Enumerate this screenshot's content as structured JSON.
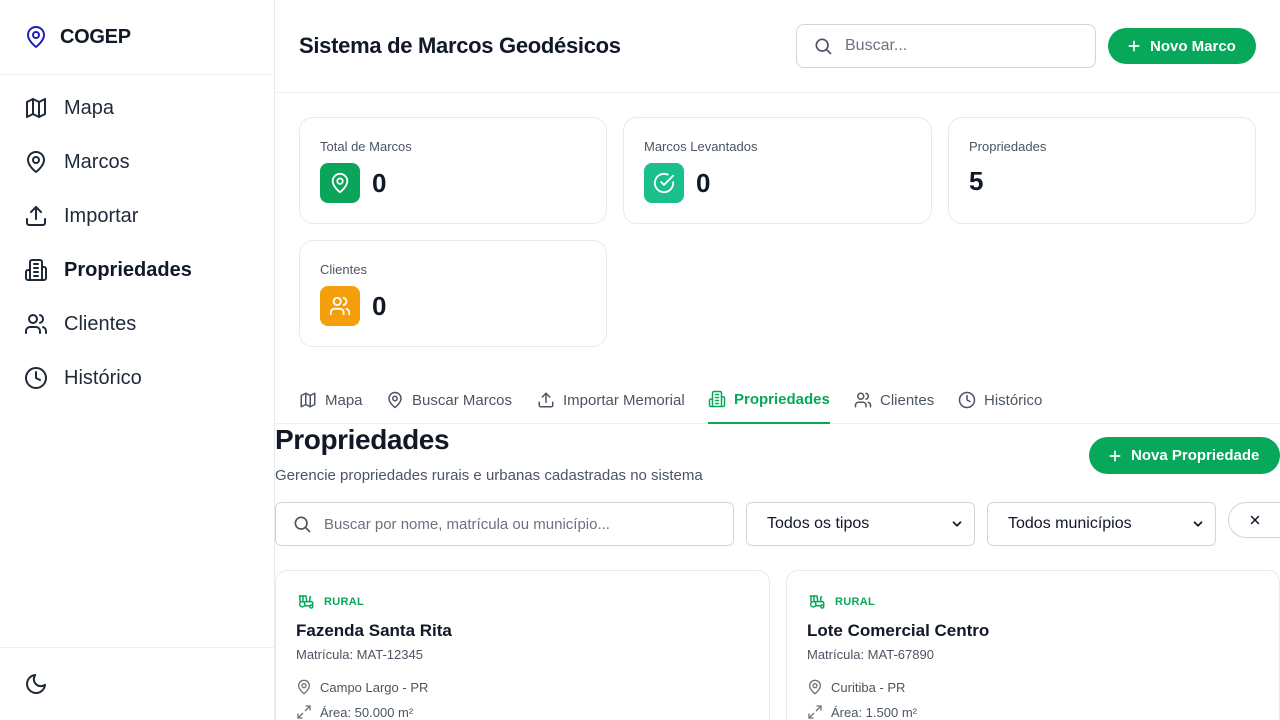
{
  "brand": {
    "name": "COGEP",
    "accent": "#07a85a",
    "brand_icon_color": "#1e1fb8"
  },
  "sidebar": {
    "items": [
      {
        "label": "Mapa",
        "icon": "map-icon",
        "active": false
      },
      {
        "label": "Marcos",
        "icon": "map-pin-icon",
        "active": false
      },
      {
        "label": "Importar",
        "icon": "upload-icon",
        "active": false
      },
      {
        "label": "Propriedades",
        "icon": "building-icon",
        "active": true
      },
      {
        "label": "Clientes",
        "icon": "users-icon",
        "active": false
      },
      {
        "label": "Histórico",
        "icon": "clock-icon",
        "active": false
      }
    ],
    "theme_toggle_icon": "moon-icon"
  },
  "header": {
    "title": "Sistema de Marcos Geodésicos",
    "search_placeholder": "Buscar...",
    "new_button": "Novo Marco"
  },
  "stats": [
    {
      "label": "Total de Marcos",
      "value": "0",
      "icon": "map-pin-icon",
      "color": "#0aa55b"
    },
    {
      "label": "Marcos Levantados",
      "value": "0",
      "icon": "check-circle-icon",
      "color": "#1bbf8b"
    },
    {
      "label": "Propriedades",
      "value": "5",
      "icon": "",
      "color": ""
    },
    {
      "label": "Clientes",
      "value": "0",
      "icon": "users-icon",
      "color": "#f59e0b"
    }
  ],
  "tabs": [
    {
      "label": "Mapa",
      "icon": "map-icon",
      "active": false
    },
    {
      "label": "Buscar Marcos",
      "icon": "map-pin-icon",
      "active": false
    },
    {
      "label": "Importar Memorial",
      "icon": "upload-icon",
      "active": false
    },
    {
      "label": "Propriedades",
      "icon": "building-icon",
      "active": true
    },
    {
      "label": "Clientes",
      "icon": "users-icon",
      "active": false
    },
    {
      "label": "Histórico",
      "icon": "clock-icon",
      "active": false
    }
  ],
  "section": {
    "title": "Propriedades",
    "subtitle": "Gerencie propriedades rurais e urbanas cadastradas no sistema",
    "new_button": "Nova Propriedade"
  },
  "filters": {
    "search_placeholder": "Buscar por nome, matrícula ou município...",
    "type_select": "Todos os tipos",
    "municipality_select": "Todos municípios"
  },
  "properties": [
    {
      "type": "RURAL",
      "name": "Fazenda Santa Rita",
      "registration": "Matrícula: MAT-12345",
      "location": "Campo Largo - PR",
      "area": "Área: 50.000 m²"
    },
    {
      "type": "RURAL",
      "name": "Lote Comercial Centro",
      "registration": "Matrícula: MAT-67890",
      "location": "Curitiba - PR",
      "area": "Área: 1.500 m²"
    }
  ]
}
